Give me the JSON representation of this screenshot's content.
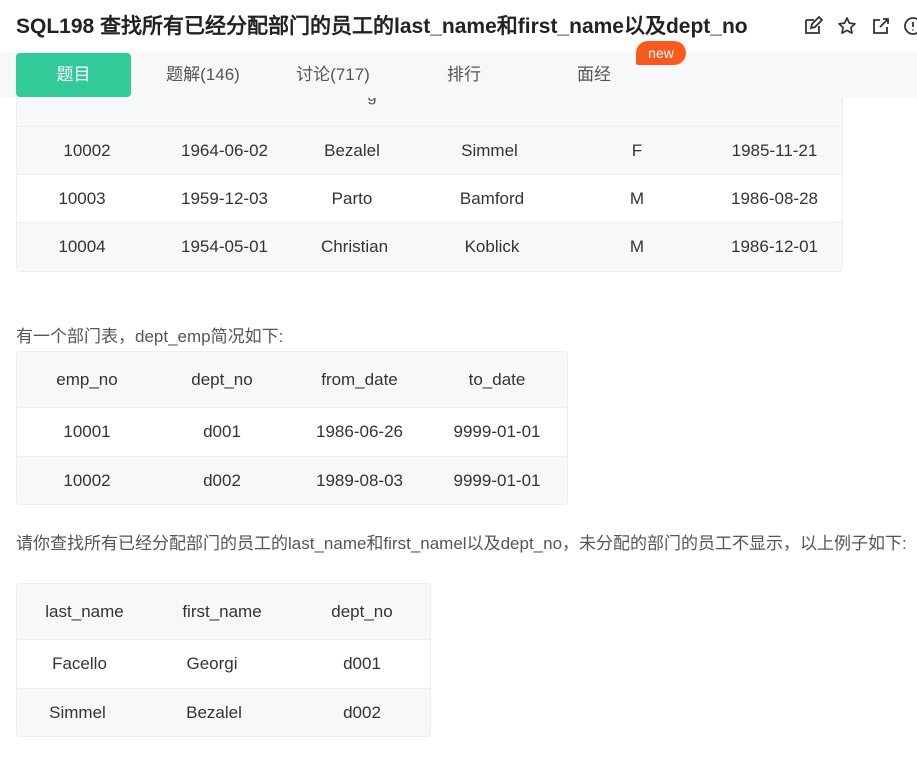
{
  "header": {
    "title": "SQL198  查找所有已经分配部门的员工的last_name和first_name以及dept_no"
  },
  "icons": {
    "edit": "edit-icon",
    "star": "star-icon",
    "external": "external-link-icon",
    "info": "info-icon"
  },
  "tabs": [
    {
      "label": "题目"
    },
    {
      "label": "题解(146)"
    },
    {
      "label": "讨论(717)"
    },
    {
      "label": "排行"
    },
    {
      "label": "面经"
    }
  ],
  "badge": "new",
  "colors": {
    "accent": "#32ca99",
    "badge": "#fa5a1e"
  },
  "employees": {
    "partial_header": "g",
    "rows": [
      [
        "10002",
        "1964-06-02",
        "Bezalel",
        "Simmel",
        "F",
        "1985-11-21"
      ],
      [
        "10003",
        "1959-12-03",
        "Parto",
        "Bamford",
        "M",
        "1986-08-28"
      ],
      [
        "10004",
        "1954-05-01",
        "Christian",
        "Koblick",
        "M",
        "1986-12-01"
      ]
    ]
  },
  "dept_emp": {
    "intro": "有一个部门表，dept_emp简况如下:",
    "headers": [
      "emp_no",
      "dept_no",
      "from_date",
      "to_date"
    ],
    "rows": [
      [
        "10001",
        "d001",
        "1986-06-26",
        "9999-01-01"
      ],
      [
        "10002",
        "d002",
        "1989-08-03",
        "9999-01-01"
      ]
    ]
  },
  "result": {
    "intro": "请你查找所有已经分配部门的员工的last_name和first_namel以及dept_no，未分配的部门的员工不显示，以上例子如下:",
    "headers": [
      "last_name",
      "first_name",
      "dept_no"
    ],
    "rows": [
      [
        "Facello",
        "Georgi",
        "d001"
      ],
      [
        "Simmel",
        "Bezalel",
        "d002"
      ]
    ]
  }
}
